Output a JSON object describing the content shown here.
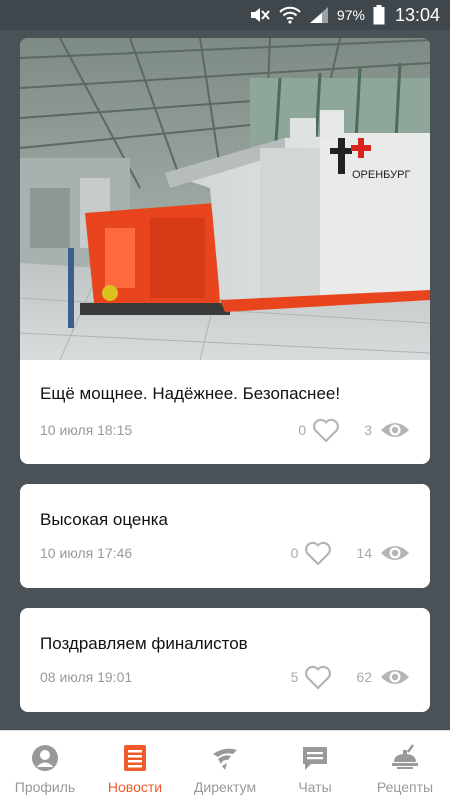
{
  "status_bar": {
    "battery_percent": "97%",
    "time": "13:04"
  },
  "colors": {
    "accent": "#f05a28",
    "background": "#4a5258",
    "muted_text": "#999999"
  },
  "news": [
    {
      "title": "Ещё мощнее. Надёжнее. Безопаснее!",
      "date": "10 июля 18:15",
      "likes": "0",
      "views": "3",
      "image": {
        "description": "industrial-turbine-hall",
        "logo_text": "ОРЕНБУРГ"
      }
    },
    {
      "title": "Высокая оценка",
      "date": "10 июля 17:46",
      "likes": "0",
      "views": "14"
    },
    {
      "title": "Поздравляем финалистов",
      "date": "08 июля 19:01",
      "likes": "5",
      "views": "62"
    }
  ],
  "bottom_nav": {
    "items": [
      {
        "label": "Профиль",
        "icon": "profile-icon"
      },
      {
        "label": "Новости",
        "icon": "news-icon"
      },
      {
        "label": "Директум",
        "icon": "directum-icon"
      },
      {
        "label": "Чаты",
        "icon": "chat-icon"
      },
      {
        "label": "Рецепты",
        "icon": "recipes-icon"
      }
    ],
    "active": "Новости"
  }
}
